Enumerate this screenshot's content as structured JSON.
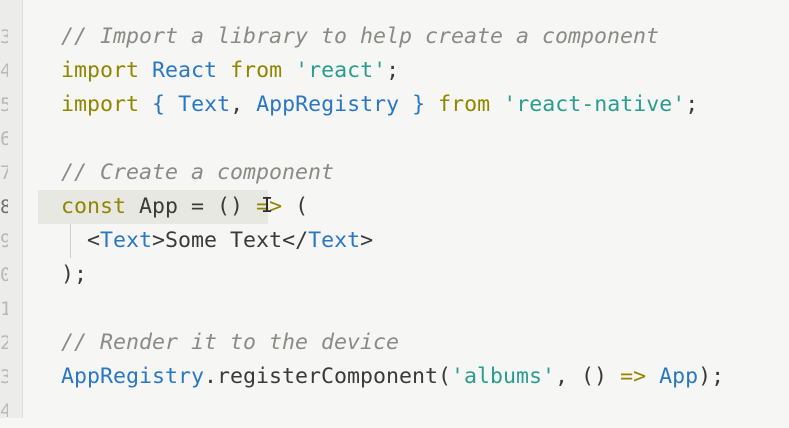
{
  "gutter": {
    "line_numbers": [
      "3",
      "4",
      "5",
      "6",
      "7",
      "8",
      "9",
      "0",
      "1",
      "2",
      "3",
      "4"
    ]
  },
  "code": {
    "line1": {
      "comment": "// Import a library to help create a component"
    },
    "line2": {
      "kw_import": "import",
      "ident_react": "React",
      "kw_from": "from",
      "str_react": "'react'",
      "semi": ";"
    },
    "line3": {
      "kw_import": "import",
      "brace_open": "{",
      "ident_text": "Text",
      "comma": ",",
      "ident_appregistry": "AppRegistry",
      "brace_close": "}",
      "kw_from": "from",
      "str_react_native": "'react-native'",
      "semi": ";"
    },
    "line4": {
      "comment": "// Create a component"
    },
    "line5": {
      "kw_const": "const",
      "plain_app": "App = ()",
      "arrow": "=>",
      "paren": "("
    },
    "line6": {
      "lt": "<",
      "tag_open": "Text",
      "gt": ">",
      "content": "Some Text",
      "lt_slash": "</",
      "tag_close": "Text",
      "gt2": ">"
    },
    "line7": {
      "text": ");"
    },
    "line8": {
      "comment": "// Render it to the device"
    },
    "line9": {
      "ident_appregistry": "AppRegistry",
      "method": ".registerComponent(",
      "str_albums": "'albums'",
      "comma_parens": ", ()",
      "arrow": "=>",
      "ident_app": "App",
      "close": ");"
    }
  },
  "cursor": {
    "glyph": "I"
  },
  "colors": {
    "background": "#f6f6f4",
    "comment": "#8a8a86",
    "keyword": "#928500",
    "identifier": "#2a77c4",
    "string": "#2a9d8f",
    "text": "#3a3a3a"
  }
}
